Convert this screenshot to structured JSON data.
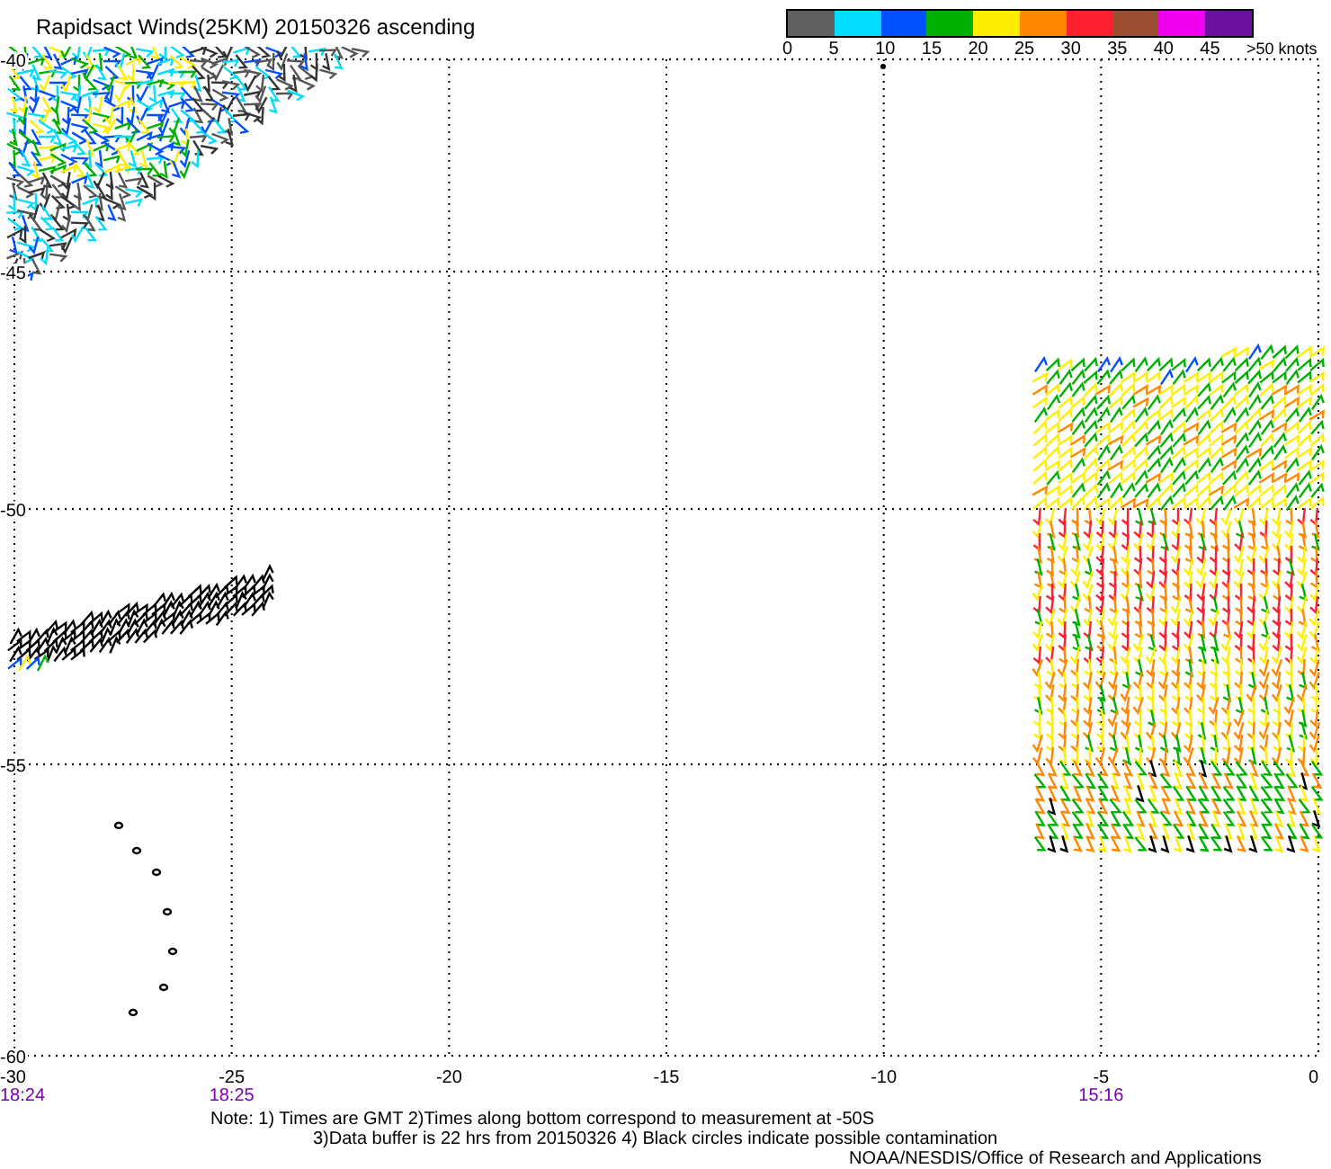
{
  "title": "Rapidsact Winds(25KM) 20150326 ascending",
  "legend": {
    "segments": [
      {
        "color": "#606060"
      },
      {
        "color": "#00ddff"
      },
      {
        "color": "#0050ff"
      },
      {
        "color": "#00b000"
      },
      {
        "color": "#ffee00"
      },
      {
        "color": "#ff8800"
      },
      {
        "color": "#ff2030"
      },
      {
        "color": "#9a5030"
      },
      {
        "color": "#ee00ee"
      },
      {
        "color": "#6a10a0"
      }
    ],
    "labels": [
      "0",
      "5",
      "10",
      "15",
      "20",
      "25",
      "30",
      "35",
      "40",
      "45",
      ">50 knots"
    ]
  },
  "map": {
    "lat_labels": [
      "-40",
      "-45",
      "-50",
      "-55",
      "-60"
    ],
    "lon_ticks": [
      {
        "label": "-30",
        "time": "18:24"
      },
      {
        "label": "-25",
        "time": "18:25"
      },
      {
        "label": "-20"
      },
      {
        "label": "-15"
      },
      {
        "label": "-10"
      },
      {
        "label": "-5",
        "time": "15:16"
      },
      {
        "label": "0"
      }
    ]
  },
  "notes": [
    "Note: 1) Times are GMT 2)Times along bottom correspond to measurement at -50S",
    "3)Data buffer is 22 hrs from 20150326 4) Black circles indicate possible contamination"
  ],
  "credit": "NOAA/NESDIS/Office of Research and Applications"
}
